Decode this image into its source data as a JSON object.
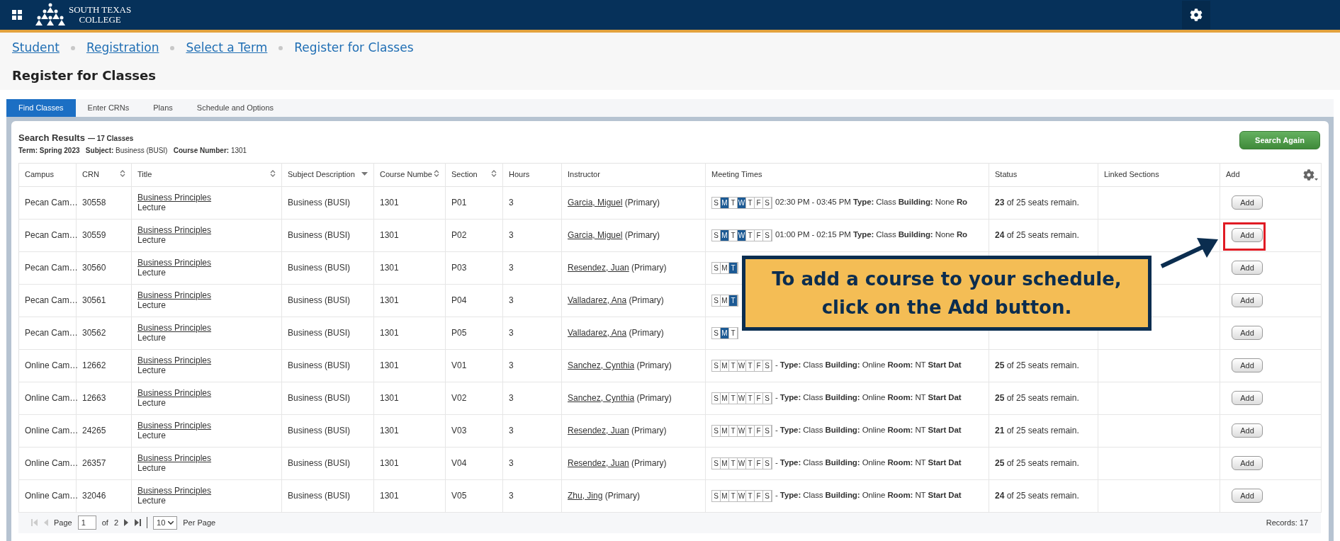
{
  "header": {
    "logo_lines": [
      "SOUTH TEXAS",
      "COLLEGE"
    ]
  },
  "breadcrumbs": [
    {
      "label": "Student",
      "link": true
    },
    {
      "label": "Registration",
      "link": true
    },
    {
      "label": "Select a Term",
      "link": true
    },
    {
      "label": "Register for Classes",
      "link": false
    }
  ],
  "page_title": "Register for Classes",
  "tabs": [
    {
      "label": "Find Classes",
      "selected": true
    },
    {
      "label": "Enter CRNs",
      "selected": false
    },
    {
      "label": "Plans",
      "selected": false
    },
    {
      "label": "Schedule and Options",
      "selected": false
    }
  ],
  "results": {
    "title": "Search Results",
    "count": "— 17 Classes",
    "criteria": "**Term: Spring 2023**   **Subject:** Business (BUSI)   **Course Number:** 1301",
    "search_again": "Search Again"
  },
  "table": {
    "columns": [
      {
        "label": "Campus",
        "kind": "plain"
      },
      {
        "label": "CRN",
        "kind": "sortable"
      },
      {
        "label": "Title",
        "kind": "sortable"
      },
      {
        "label": "Subject Description",
        "kind": "filter"
      },
      {
        "label": "Course Numbe",
        "kind": "sortable"
      },
      {
        "label": "Section",
        "kind": "sortable"
      },
      {
        "label": "Hours",
        "kind": "plain"
      },
      {
        "label": "Instructor",
        "kind": "plain"
      },
      {
        "label": "Meeting Times",
        "kind": "plain"
      },
      {
        "label": "Status",
        "kind": "plain"
      },
      {
        "label": "Linked Sections",
        "kind": "plain"
      },
      {
        "label": "Add",
        "kind": "plain"
      }
    ],
    "rows": [
      {
        "campus": "Pecan Cam…",
        "crn": "30558",
        "title": "Business Principles",
        "schedule_type": "Lecture",
        "subject": "Business (BUSI)",
        "course": "1301",
        "section": "P01",
        "hours": "3",
        "instructor": "Garcia, Miguel",
        "role": "(Primary)",
        "days": [
          {
            "letter": "S",
            "selected": false
          },
          {
            "letter": "M",
            "selected": true
          },
          {
            "letter": "T",
            "selected": false
          },
          {
            "letter": "W",
            "selected": true
          },
          {
            "letter": "T",
            "selected": false
          },
          {
            "letter": "F",
            "selected": false
          },
          {
            "letter": "S",
            "selected": false
          }
        ],
        "meeting": "02:30 PM - 03:45 PM **Type:** Class  **Building:** None  **Ro**",
        "status": "**23** of 25 seats remain.",
        "add": "Add",
        "highlighted": false
      },
      {
        "campus": "Pecan Cam…",
        "crn": "30559",
        "title": "Business Principles",
        "schedule_type": "Lecture",
        "subject": "Business (BUSI)",
        "course": "1301",
        "section": "P02",
        "hours": "3",
        "instructor": "Garcia, Miguel",
        "role": "(Primary)",
        "days": [
          {
            "letter": "S",
            "selected": false
          },
          {
            "letter": "M",
            "selected": true
          },
          {
            "letter": "T",
            "selected": false
          },
          {
            "letter": "W",
            "selected": true
          },
          {
            "letter": "T",
            "selected": false
          },
          {
            "letter": "F",
            "selected": false
          },
          {
            "letter": "S",
            "selected": false
          }
        ],
        "meeting": "01:00 PM - 02:15 PM **Type:** Class  **Building:** None  **Ro**",
        "status": "**24** of 25 seats remain.",
        "add": "Add",
        "highlighted": true
      },
      {
        "campus": "Pecan Cam…",
        "crn": "30560",
        "title": "Business Principles",
        "schedule_type": "Lecture",
        "subject": "Business (BUSI)",
        "course": "1301",
        "section": "P03",
        "hours": "3",
        "instructor": "Resendez, Juan",
        "role": "(Primary)",
        "days": [
          {
            "letter": "S",
            "selected": false
          },
          {
            "letter": "M",
            "selected": false
          },
          {
            "letter": "T",
            "selected": true
          }
        ],
        "add": "Add",
        "highlighted": false
      },
      {
        "campus": "Pecan Cam…",
        "crn": "30561",
        "title": "Business Principles",
        "schedule_type": "Lecture",
        "subject": "Business (BUSI)",
        "course": "1301",
        "section": "P04",
        "hours": "3",
        "instructor": "Valladarez, Ana",
        "role": "(Primary)",
        "days": [
          {
            "letter": "S",
            "selected": false
          },
          {
            "letter": "M",
            "selected": false
          },
          {
            "letter": "T",
            "selected": true
          }
        ],
        "add": "Add",
        "highlighted": false
      },
      {
        "campus": "Pecan Cam…",
        "crn": "30562",
        "title": "Business Principles",
        "schedule_type": "Lecture",
        "subject": "Business (BUSI)",
        "course": "1301",
        "section": "P05",
        "hours": "3",
        "instructor": "Valladarez, Ana",
        "role": "(Primary)",
        "days": [
          {
            "letter": "S",
            "selected": false
          },
          {
            "letter": "M",
            "selected": true
          },
          {
            "letter": "T",
            "selected": false
          }
        ],
        "add": "Add",
        "highlighted": false
      },
      {
        "campus": "Online Cam…",
        "crn": "12662",
        "title": "Business Principles",
        "schedule_type": "Lecture",
        "subject": "Business (BUSI)",
        "course": "1301",
        "section": "V01",
        "hours": "3",
        "instructor": "Sanchez, Cynthia",
        "role": "(Primary)",
        "days": [
          {
            "letter": "S",
            "selected": false
          },
          {
            "letter": "M",
            "selected": false
          },
          {
            "letter": "T",
            "selected": false
          },
          {
            "letter": "W",
            "selected": false
          },
          {
            "letter": "T",
            "selected": false
          },
          {
            "letter": "F",
            "selected": false
          },
          {
            "letter": "S",
            "selected": false
          }
        ],
        "meeting": " - **Type:** Class  **Building:** Online  **Room:** NT  **Start Dat**",
        "status": "**25** of 25 seats remain.",
        "add": "Add",
        "highlighted": false
      },
      {
        "campus": "Online Cam…",
        "crn": "12663",
        "title": "Business Principles",
        "schedule_type": "Lecture",
        "subject": "Business (BUSI)",
        "course": "1301",
        "section": "V02",
        "hours": "3",
        "instructor": "Sanchez, Cynthia",
        "role": "(Primary)",
        "days": [
          {
            "letter": "S",
            "selected": false
          },
          {
            "letter": "M",
            "selected": false
          },
          {
            "letter": "T",
            "selected": false
          },
          {
            "letter": "W",
            "selected": false
          },
          {
            "letter": "T",
            "selected": false
          },
          {
            "letter": "F",
            "selected": false
          },
          {
            "letter": "S",
            "selected": false
          }
        ],
        "meeting": " - **Type:** Class  **Building:** Online  **Room:** NT  **Start Dat**",
        "status": "**25** of 25 seats remain.",
        "add": "Add",
        "highlighted": false
      },
      {
        "campus": "Online Cam…",
        "crn": "24265",
        "title": "Business Principles",
        "schedule_type": "Lecture",
        "subject": "Business (BUSI)",
        "course": "1301",
        "section": "V03",
        "hours": "3",
        "instructor": "Resendez, Juan",
        "role": "(Primary)",
        "days": [
          {
            "letter": "S",
            "selected": false
          },
          {
            "letter": "M",
            "selected": false
          },
          {
            "letter": "T",
            "selected": false
          },
          {
            "letter": "W",
            "selected": false
          },
          {
            "letter": "T",
            "selected": false
          },
          {
            "letter": "F",
            "selected": false
          },
          {
            "letter": "S",
            "selected": false
          }
        ],
        "meeting": " - **Type:** Class  **Building:** Online  **Room:** NT  **Start Dat**",
        "status": "**21** of 25 seats remain.",
        "add": "Add",
        "highlighted": false
      },
      {
        "campus": "Online Cam…",
        "crn": "26357",
        "title": "Business Principles",
        "schedule_type": "Lecture",
        "subject": "Business (BUSI)",
        "course": "1301",
        "section": "V04",
        "hours": "3",
        "instructor": "Resendez, Juan",
        "role": "(Primary)",
        "days": [
          {
            "letter": "S",
            "selected": false
          },
          {
            "letter": "M",
            "selected": false
          },
          {
            "letter": "T",
            "selected": false
          },
          {
            "letter": "W",
            "selected": false
          },
          {
            "letter": "T",
            "selected": false
          },
          {
            "letter": "F",
            "selected": false
          },
          {
            "letter": "S",
            "selected": false
          }
        ],
        "meeting": " - **Type:** Class  **Building:** Online  **Room:** NT  **Start Dat**",
        "status": "**25** of 25 seats remain.",
        "add": "Add",
        "highlighted": false
      },
      {
        "campus": "Online Cam…",
        "crn": "32046",
        "title": "Business Principles",
        "schedule_type": "Lecture",
        "subject": "Business (BUSI)",
        "course": "1301",
        "section": "V05",
        "hours": "3",
        "instructor": "Zhu, Jing",
        "role": "(Primary)",
        "days": [
          {
            "letter": "S",
            "selected": false
          },
          {
            "letter": "M",
            "selected": false
          },
          {
            "letter": "T",
            "selected": false
          },
          {
            "letter": "W",
            "selected": false
          },
          {
            "letter": "T",
            "selected": false
          },
          {
            "letter": "F",
            "selected": false
          },
          {
            "letter": "S",
            "selected": false
          }
        ],
        "meeting": " - **Type:** Class  **Building:** Online  **Room:** NT  **Start Dat**",
        "status": "**24** of 25 seats remain.",
        "add": "Add",
        "highlighted": false
      }
    ]
  },
  "pagination": {
    "page_label": "Page",
    "page": "1",
    "of_label": "of",
    "total_pages": "2",
    "per_page": "10",
    "per_page_label": "Per Page",
    "records": "Records: 17"
  },
  "callout": {
    "lines": [
      "To add a course to your schedule,",
      "click on the Add button."
    ]
  }
}
